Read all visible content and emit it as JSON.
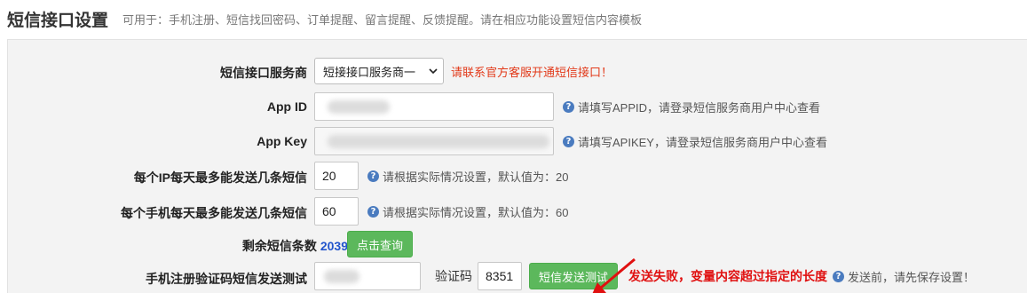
{
  "header": {
    "title": "短信接口设置",
    "description": "可用于：手机注册、短信找回密码、订单提醒、留言提醒、反馈提醒。请在相应功能设置短信内容模板"
  },
  "provider": {
    "label": "短信接口服务商",
    "selected": "短接接口服务商一",
    "note": "请联系官方客服开通短信接口！"
  },
  "app_id": {
    "label": "App ID",
    "hint": "请填写APPID，请登录短信服务商用户中心查看"
  },
  "app_key": {
    "label": "App Key",
    "hint": "请填写APIKEY，请登录短信服务商用户中心查看"
  },
  "ip_limit": {
    "label": "每个IP每天最多能发送几条短信",
    "value": "20",
    "hint": "请根据实际情况设置，默认值为：20"
  },
  "phone_limit": {
    "label": "每个手机每天最多能发送几条短信",
    "value": "60",
    "hint": "请根据实际情况设置，默认值为：60"
  },
  "remaining": {
    "label": "剩余短信条数",
    "count": "2039",
    "button": "点击查询"
  },
  "test": {
    "label": "手机注册验证码短信发送测试",
    "code_label": "验证码",
    "code_value": "8351",
    "button": "短信发送测试",
    "fail_message": "发送失败，变量内容超过指定的长度",
    "hint": "发送前，请先保存设置！"
  },
  "icons": {
    "help": "question-circle-icon",
    "dropdown": "chevron-down-icon",
    "annotation": "red-arrow-icon"
  },
  "colors": {
    "accent_green": "#5cb85c",
    "error_red": "#e01010",
    "note_red": "#e23a1a",
    "count_blue": "#2255cc",
    "help_blue": "#4a7bbf"
  }
}
